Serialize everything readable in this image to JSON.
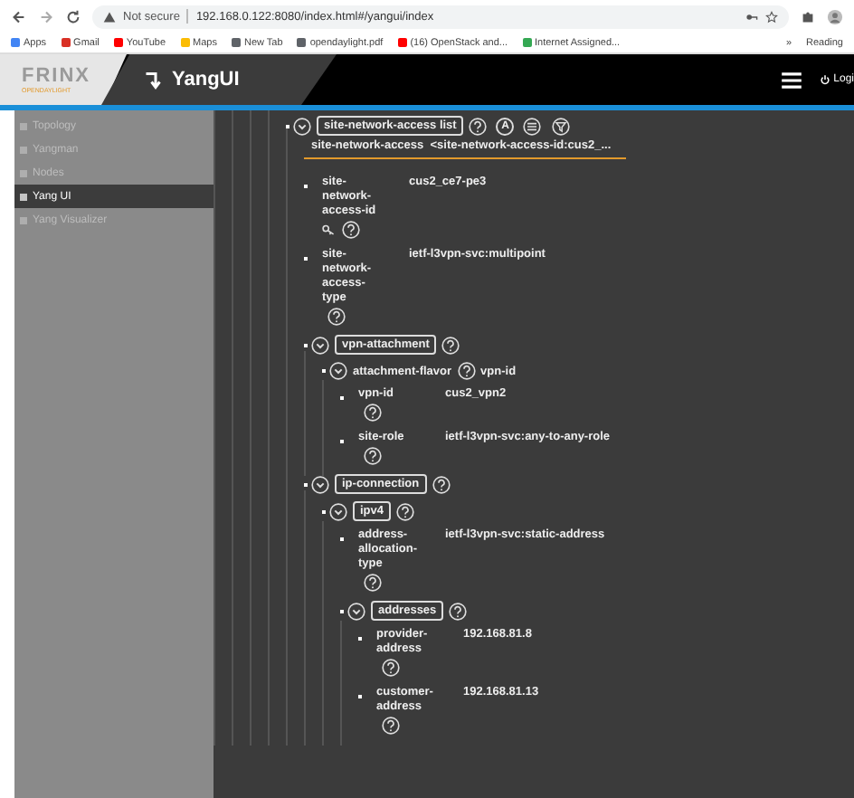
{
  "browser": {
    "security": "Not secure",
    "url": "192.168.0.122:8080/index.html#/yangui/index",
    "bookmarks": [
      {
        "label": "Apps",
        "color": "#4285f4"
      },
      {
        "label": "Gmail",
        "color": "#d93025"
      },
      {
        "label": "YouTube",
        "color": "#ff0000"
      },
      {
        "label": "Maps",
        "color": "#fbbc04"
      },
      {
        "label": "New Tab",
        "color": "#5f6368"
      },
      {
        "label": "opendaylight.pdf",
        "color": "#5f6368"
      },
      {
        "label": "(16) OpenStack and...",
        "color": "#ff0000"
      },
      {
        "label": "Internet Assigned...",
        "color": "#34a853"
      }
    ],
    "overflow": "»",
    "reading_list": "Reading"
  },
  "header": {
    "logo": "FRINX",
    "logo_sub": "OPENDAYLIGHT",
    "title": "YangUI",
    "login": "Logi"
  },
  "sidebar": [
    {
      "label": "Topology",
      "selected": false
    },
    {
      "label": "Yangman",
      "selected": false
    },
    {
      "label": "Nodes",
      "selected": false
    },
    {
      "label": "Yang UI",
      "selected": true
    },
    {
      "label": "Yang Visualizer",
      "selected": false
    }
  ],
  "tree": [
    {
      "kind": "list",
      "label": "site-network-access list",
      "expanded": true,
      "actions": [
        {
          "kind": "letter",
          "label": "A"
        },
        {
          "kind": "lines"
        },
        {
          "kind": "filter"
        }
      ],
      "item": {
        "name": "site-network-access",
        "key": "<site-network-access-id:cus2_..."
      },
      "children": [
        {
          "kind": "leaf",
          "label": "site-network-access-id",
          "value": "cus2_ce7-pe3",
          "is_key": true
        },
        {
          "kind": "leaf",
          "label": "site-network-access-type",
          "value": "ietf-l3vpn-svc:multipoint",
          "is_key": false
        },
        {
          "kind": "container",
          "label": "vpn-attachment",
          "expanded": true,
          "children": [
            {
              "kind": "choice",
              "label": "attachment-flavor",
              "case": "vpn-id",
              "expanded": true,
              "children": [
                {
                  "kind": "leaf",
                  "label": "vpn-id",
                  "value": "cus2_vpn2",
                  "is_key": false
                },
                {
                  "kind": "leaf",
                  "label": "site-role",
                  "value": "ietf-l3vpn-svc:any-to-any-role",
                  "is_key": false
                }
              ]
            }
          ]
        },
        {
          "kind": "container",
          "label": "ip-connection",
          "expanded": true,
          "children": [
            {
              "kind": "container",
              "label": "ipv4",
              "expanded": true,
              "children": [
                {
                  "kind": "leaf",
                  "label": "address-allocation-type",
                  "value": "ietf-l3vpn-svc:static-address",
                  "is_key": false
                },
                {
                  "kind": "container",
                  "label": "addresses",
                  "expanded": true,
                  "children": [
                    {
                      "kind": "leaf",
                      "label": "provider-address",
                      "value": "192.168.81.8",
                      "is_key": false
                    },
                    {
                      "kind": "leaf",
                      "label": "customer-address",
                      "value": "192.168.81.13",
                      "is_key": false
                    }
                  ]
                }
              ]
            }
          ]
        }
      ]
    }
  ]
}
